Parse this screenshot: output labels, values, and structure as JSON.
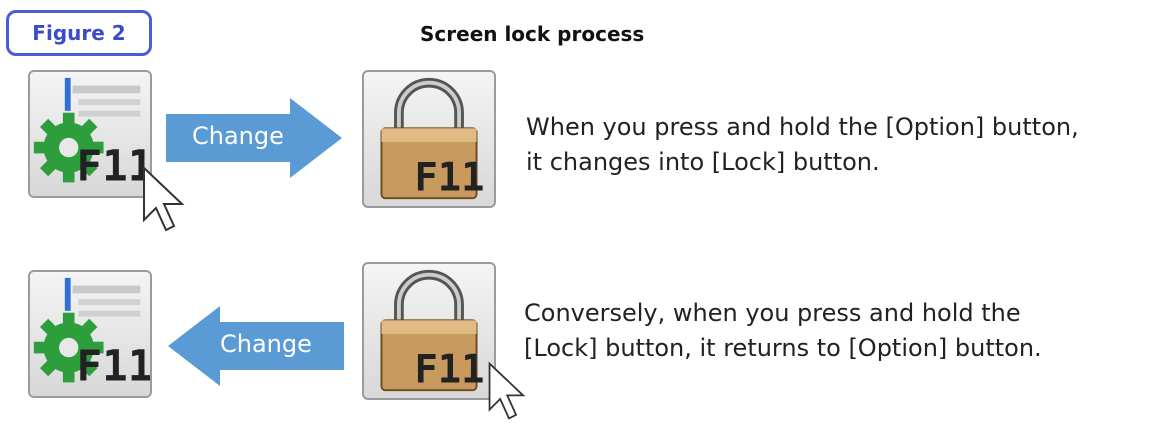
{
  "figure_label": "Figure 2",
  "title": "Screen lock process",
  "rows": [
    {
      "from_button": "option-button",
      "to_button": "lock-button",
      "arrow_direction": "right",
      "arrow_label": "Change",
      "description_lines": [
        "When you press and hold the [Option] button,",
        "it changes into [Lock] button."
      ]
    },
    {
      "from_button": "lock-button",
      "to_button": "option-button",
      "arrow_direction": "left",
      "arrow_label": "Change",
      "description_lines": [
        "Conversely, when you press and hold the",
        "[Lock] button, it returns to [Option] button."
      ]
    }
  ],
  "key_label": "F11",
  "colors": {
    "badge_border": "#4d5bd6",
    "arrow_fill": "#5b9bd5",
    "gear": "#2e9e3c",
    "lock_body": "#c89a5e"
  }
}
